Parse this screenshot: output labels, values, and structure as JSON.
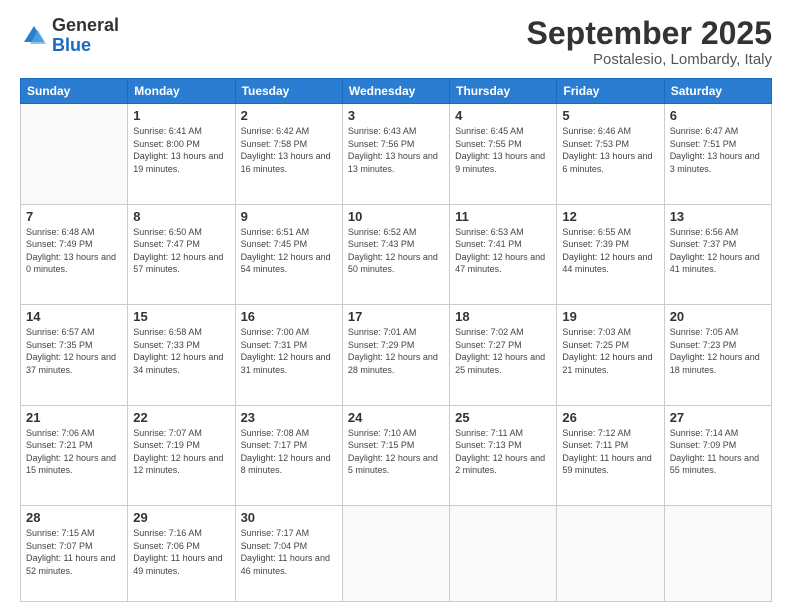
{
  "logo": {
    "general": "General",
    "blue": "Blue"
  },
  "title": "September 2025",
  "location": "Postalesio, Lombardy, Italy",
  "days_header": [
    "Sunday",
    "Monday",
    "Tuesday",
    "Wednesday",
    "Thursday",
    "Friday",
    "Saturday"
  ],
  "weeks": [
    [
      {
        "day": "",
        "sunrise": "",
        "sunset": "",
        "daylight": ""
      },
      {
        "day": "1",
        "sunrise": "Sunrise: 6:41 AM",
        "sunset": "Sunset: 8:00 PM",
        "daylight": "Daylight: 13 hours and 19 minutes."
      },
      {
        "day": "2",
        "sunrise": "Sunrise: 6:42 AM",
        "sunset": "Sunset: 7:58 PM",
        "daylight": "Daylight: 13 hours and 16 minutes."
      },
      {
        "day": "3",
        "sunrise": "Sunrise: 6:43 AM",
        "sunset": "Sunset: 7:56 PM",
        "daylight": "Daylight: 13 hours and 13 minutes."
      },
      {
        "day": "4",
        "sunrise": "Sunrise: 6:45 AM",
        "sunset": "Sunset: 7:55 PM",
        "daylight": "Daylight: 13 hours and 9 minutes."
      },
      {
        "day": "5",
        "sunrise": "Sunrise: 6:46 AM",
        "sunset": "Sunset: 7:53 PM",
        "daylight": "Daylight: 13 hours and 6 minutes."
      },
      {
        "day": "6",
        "sunrise": "Sunrise: 6:47 AM",
        "sunset": "Sunset: 7:51 PM",
        "daylight": "Daylight: 13 hours and 3 minutes."
      }
    ],
    [
      {
        "day": "7",
        "sunrise": "Sunrise: 6:48 AM",
        "sunset": "Sunset: 7:49 PM",
        "daylight": "Daylight: 13 hours and 0 minutes."
      },
      {
        "day": "8",
        "sunrise": "Sunrise: 6:50 AM",
        "sunset": "Sunset: 7:47 PM",
        "daylight": "Daylight: 12 hours and 57 minutes."
      },
      {
        "day": "9",
        "sunrise": "Sunrise: 6:51 AM",
        "sunset": "Sunset: 7:45 PM",
        "daylight": "Daylight: 12 hours and 54 minutes."
      },
      {
        "day": "10",
        "sunrise": "Sunrise: 6:52 AM",
        "sunset": "Sunset: 7:43 PM",
        "daylight": "Daylight: 12 hours and 50 minutes."
      },
      {
        "day": "11",
        "sunrise": "Sunrise: 6:53 AM",
        "sunset": "Sunset: 7:41 PM",
        "daylight": "Daylight: 12 hours and 47 minutes."
      },
      {
        "day": "12",
        "sunrise": "Sunrise: 6:55 AM",
        "sunset": "Sunset: 7:39 PM",
        "daylight": "Daylight: 12 hours and 44 minutes."
      },
      {
        "day": "13",
        "sunrise": "Sunrise: 6:56 AM",
        "sunset": "Sunset: 7:37 PM",
        "daylight": "Daylight: 12 hours and 41 minutes."
      }
    ],
    [
      {
        "day": "14",
        "sunrise": "Sunrise: 6:57 AM",
        "sunset": "Sunset: 7:35 PM",
        "daylight": "Daylight: 12 hours and 37 minutes."
      },
      {
        "day": "15",
        "sunrise": "Sunrise: 6:58 AM",
        "sunset": "Sunset: 7:33 PM",
        "daylight": "Daylight: 12 hours and 34 minutes."
      },
      {
        "day": "16",
        "sunrise": "Sunrise: 7:00 AM",
        "sunset": "Sunset: 7:31 PM",
        "daylight": "Daylight: 12 hours and 31 minutes."
      },
      {
        "day": "17",
        "sunrise": "Sunrise: 7:01 AM",
        "sunset": "Sunset: 7:29 PM",
        "daylight": "Daylight: 12 hours and 28 minutes."
      },
      {
        "day": "18",
        "sunrise": "Sunrise: 7:02 AM",
        "sunset": "Sunset: 7:27 PM",
        "daylight": "Daylight: 12 hours and 25 minutes."
      },
      {
        "day": "19",
        "sunrise": "Sunrise: 7:03 AM",
        "sunset": "Sunset: 7:25 PM",
        "daylight": "Daylight: 12 hours and 21 minutes."
      },
      {
        "day": "20",
        "sunrise": "Sunrise: 7:05 AM",
        "sunset": "Sunset: 7:23 PM",
        "daylight": "Daylight: 12 hours and 18 minutes."
      }
    ],
    [
      {
        "day": "21",
        "sunrise": "Sunrise: 7:06 AM",
        "sunset": "Sunset: 7:21 PM",
        "daylight": "Daylight: 12 hours and 15 minutes."
      },
      {
        "day": "22",
        "sunrise": "Sunrise: 7:07 AM",
        "sunset": "Sunset: 7:19 PM",
        "daylight": "Daylight: 12 hours and 12 minutes."
      },
      {
        "day": "23",
        "sunrise": "Sunrise: 7:08 AM",
        "sunset": "Sunset: 7:17 PM",
        "daylight": "Daylight: 12 hours and 8 minutes."
      },
      {
        "day": "24",
        "sunrise": "Sunrise: 7:10 AM",
        "sunset": "Sunset: 7:15 PM",
        "daylight": "Daylight: 12 hours and 5 minutes."
      },
      {
        "day": "25",
        "sunrise": "Sunrise: 7:11 AM",
        "sunset": "Sunset: 7:13 PM",
        "daylight": "Daylight: 12 hours and 2 minutes."
      },
      {
        "day": "26",
        "sunrise": "Sunrise: 7:12 AM",
        "sunset": "Sunset: 7:11 PM",
        "daylight": "Daylight: 11 hours and 59 minutes."
      },
      {
        "day": "27",
        "sunrise": "Sunrise: 7:14 AM",
        "sunset": "Sunset: 7:09 PM",
        "daylight": "Daylight: 11 hours and 55 minutes."
      }
    ],
    [
      {
        "day": "28",
        "sunrise": "Sunrise: 7:15 AM",
        "sunset": "Sunset: 7:07 PM",
        "daylight": "Daylight: 11 hours and 52 minutes."
      },
      {
        "day": "29",
        "sunrise": "Sunrise: 7:16 AM",
        "sunset": "Sunset: 7:06 PM",
        "daylight": "Daylight: 11 hours and 49 minutes."
      },
      {
        "day": "30",
        "sunrise": "Sunrise: 7:17 AM",
        "sunset": "Sunset: 7:04 PM",
        "daylight": "Daylight: 11 hours and 46 minutes."
      },
      {
        "day": "",
        "sunrise": "",
        "sunset": "",
        "daylight": ""
      },
      {
        "day": "",
        "sunrise": "",
        "sunset": "",
        "daylight": ""
      },
      {
        "day": "",
        "sunrise": "",
        "sunset": "",
        "daylight": ""
      },
      {
        "day": "",
        "sunrise": "",
        "sunset": "",
        "daylight": ""
      }
    ]
  ]
}
